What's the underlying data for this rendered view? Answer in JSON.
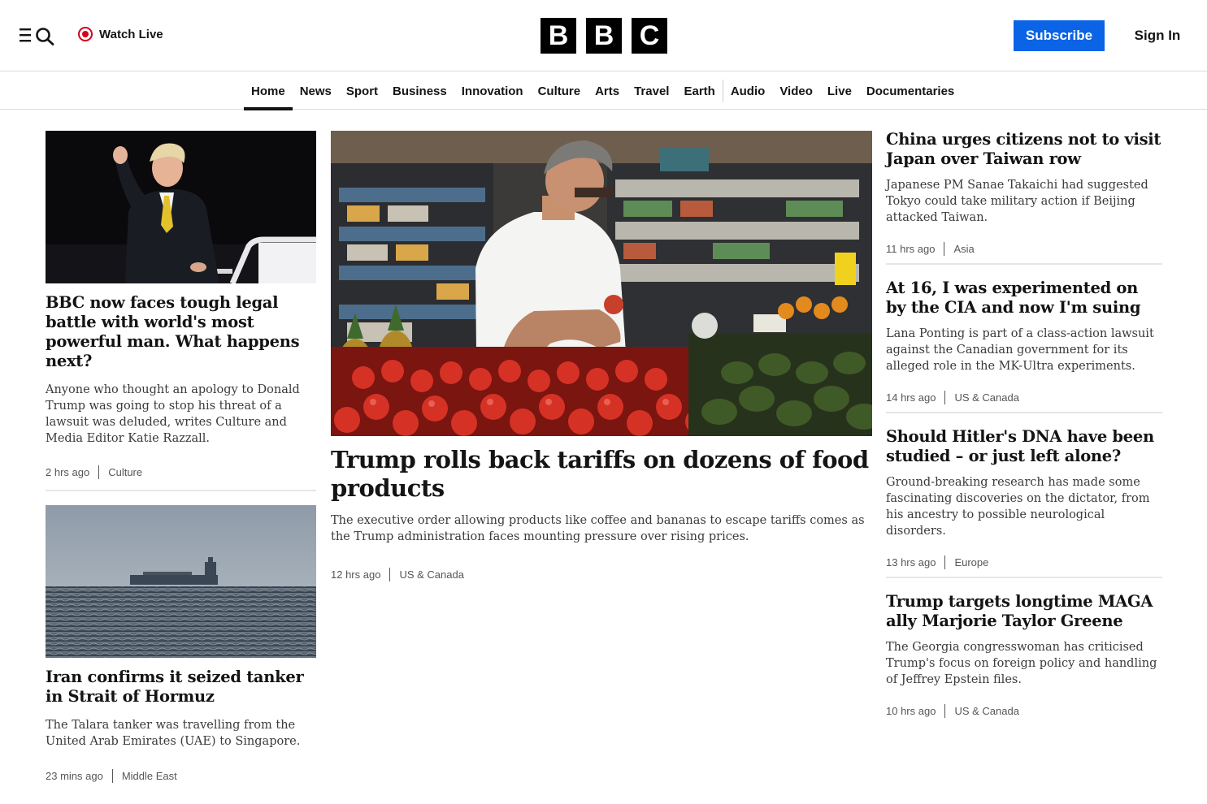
{
  "header": {
    "menu_icon": "menu-icon",
    "search_icon": "search-icon",
    "watch_live_label": "Watch Live",
    "logo_letters": [
      "B",
      "B",
      "C"
    ],
    "subscribe_label": "Subscribe",
    "signin_label": "Sign In",
    "accent_color": "#0b63e5",
    "live_color": "#d6001c"
  },
  "nav": {
    "items": [
      "Home",
      "News",
      "Sport",
      "Business",
      "Innovation",
      "Culture",
      "Arts",
      "Travel",
      "Earth",
      "Audio",
      "Video",
      "Live",
      "Documentaries"
    ],
    "active": "Home"
  },
  "left_stories": [
    {
      "image": "trump-raising-fist-at-night",
      "headline": "BBC now faces tough legal battle with world's most powerful man. What happens next?",
      "summary": "Anyone who thought an apology to Donald Trump was going to stop his threat of a lawsuit was deluded, writes Culture and Media Editor Katie Razzall.",
      "time": "2 hrs ago",
      "category": "Culture"
    },
    {
      "image": "tanker-on-hazy-sea",
      "headline": "Iran confirms it seized tanker in Strait of Hormuz",
      "summary": "The Talara tanker was travelling from the United Arab Emirates (UAE) to Singapore.",
      "time": "23 mins ago",
      "category": "Middle East"
    }
  ],
  "lead_story": {
    "image": "man-inspecting-tomatoes-in-grocery-store",
    "headline": "Trump rolls back tariffs on dozens of food products",
    "summary": "The executive order allowing products like coffee and bananas to escape tariffs comes as the Trump administration faces mounting pressure over rising prices.",
    "time": "12 hrs ago",
    "category": "US & Canada"
  },
  "right_stories": [
    {
      "headline": "China urges citizens not to visit Japan over Taiwan row",
      "summary": "Japanese PM Sanae Takaichi had suggested Tokyo could take military action if Beijing attacked Taiwan.",
      "time": "11 hrs ago",
      "category": "Asia"
    },
    {
      "headline": "At 16, I was experimented on by the CIA and now I'm suing",
      "summary": "Lana Ponting is part of a class-action lawsuit against the Canadian government for its alleged role in the MK-Ultra experiments.",
      "time": "14 hrs ago",
      "category": "US & Canada"
    },
    {
      "headline": "Should Hitler's DNA have been studied – or just left alone?",
      "summary": "Ground-breaking research has made some fascinating discoveries on the dictator, from his ancestry to possible neurological disorders.",
      "time": "13 hrs ago",
      "category": "Europe"
    },
    {
      "headline": "Trump targets longtime MAGA ally Marjorie Taylor Greene",
      "summary": "The Georgia congresswoman has criticised Trump's focus on foreign policy and handling of Jeffrey Epstein files.",
      "time": "10 hrs ago",
      "category": "US & Canada"
    }
  ]
}
